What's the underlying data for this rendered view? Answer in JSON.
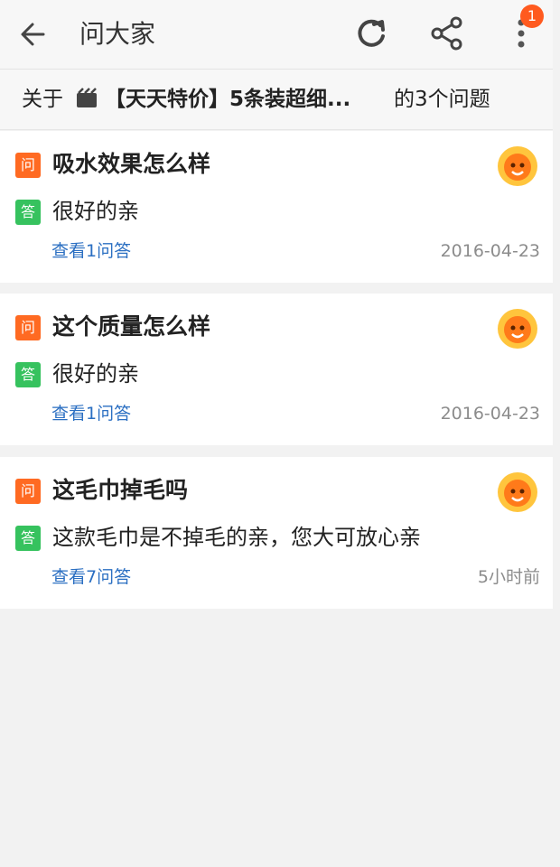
{
  "header": {
    "title": "问大家",
    "notification_count": "1"
  },
  "subheader": {
    "prefix": "关于",
    "product_name": "【天天特价】5条装超细...",
    "question_count_text": "的3个问题"
  },
  "questions": [
    {
      "question": "吸水效果怎么样",
      "answer": "很好的亲",
      "view_label": "查看1问答",
      "date": "2016-04-23",
      "q_label": "问",
      "a_label": "答"
    },
    {
      "question": "这个质量怎么样",
      "answer": "很好的亲",
      "view_label": "查看1问答",
      "date": "2016-04-23",
      "q_label": "问",
      "a_label": "答"
    },
    {
      "question": "这毛巾掉毛吗",
      "answer": "这款毛巾是不掉毛的亲，您大可放心亲",
      "view_label": "查看7问答",
      "date": "5小时前",
      "q_label": "问",
      "a_label": "答"
    }
  ],
  "colors": {
    "question_badge": "#ff6a22",
    "answer_badge": "#36c25e",
    "link": "#2b6fc2",
    "notification_badge": "#ff5a1f"
  },
  "icons": [
    "back-arrow-icon",
    "refresh-icon",
    "share-icon",
    "more-vertical-icon",
    "product-icon",
    "avatar-icon"
  ]
}
